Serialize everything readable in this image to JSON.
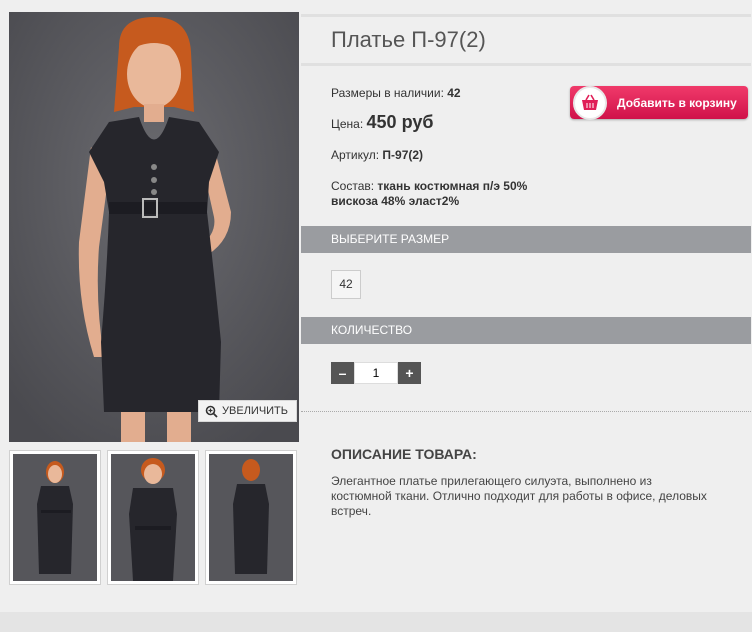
{
  "product": {
    "title": "Платье П-97(2)",
    "sizes_label": "Размеры в наличии: ",
    "sizes_value": "42",
    "price_label": "Цена: ",
    "price_value": "450 руб",
    "sku_label": "Артикул: ",
    "sku_value": "П-97(2)",
    "composition_label": "Состав: ",
    "composition_value_1": "ткань костюмная п/э 50%",
    "composition_value_2": "вискоза 48% эласт2%"
  },
  "cart": {
    "label": "Добавить в корзину",
    "accent": "#e01e57"
  },
  "gallery": {
    "zoom_label": "УВЕЛИЧИТЬ"
  },
  "size_section": {
    "title": "ВЫБЕРИТЕ РАЗМЕР",
    "option": "42"
  },
  "quantity_section": {
    "title": "КОЛИЧЕСТВО",
    "minus": "–",
    "plus": "+",
    "value": "1"
  },
  "description": {
    "title": "ОПИСАНИЕ ТОВАРА:",
    "text": "Элегантное платье прилегающего силуэта, выполнено из костюмной ткани. Отлично подходит для работы в офисе, деловых встреч."
  }
}
